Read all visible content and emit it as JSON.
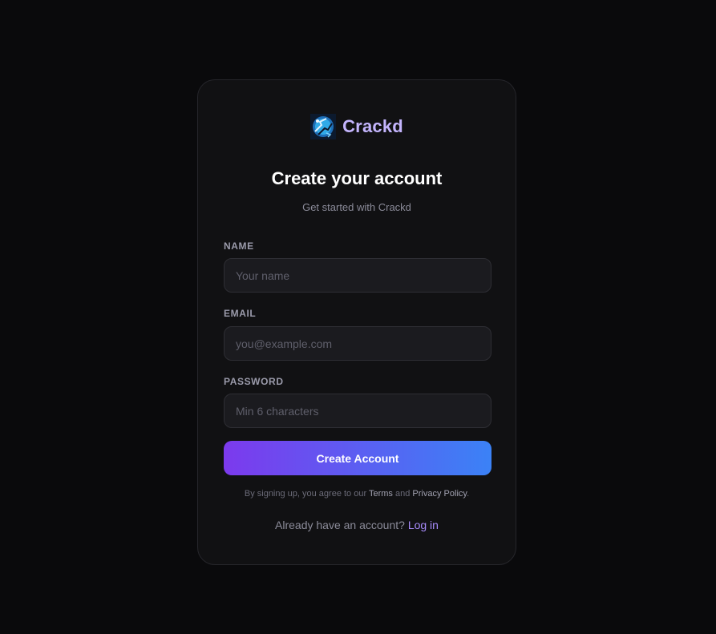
{
  "brand": {
    "name": "Crackd",
    "logo_icon": "crackd-logo-icon",
    "color": "#c4b5fd"
  },
  "header": {
    "title": "Create your account",
    "subtitle": "Get started with Crackd"
  },
  "form": {
    "name": {
      "label": "NAME",
      "placeholder": "Your name",
      "value": ""
    },
    "email": {
      "label": "EMAIL",
      "placeholder": "you@example.com",
      "value": ""
    },
    "password": {
      "label": "PASSWORD",
      "placeholder": "Min 6 characters",
      "value": ""
    },
    "submit_label": "Create Account"
  },
  "terms": {
    "prefix": "By signing up, you agree to our",
    "terms_link": "Terms",
    "and": "and",
    "privacy_link": "Privacy Policy",
    "suffix": "."
  },
  "footer": {
    "prompt": "Already have an account?",
    "login_link": "Log in"
  },
  "colors": {
    "background": "#0a0a0c",
    "card": "#111113",
    "accent_start": "#7c3aed",
    "accent_end": "#3b82f6",
    "link": "#a78bfa"
  }
}
